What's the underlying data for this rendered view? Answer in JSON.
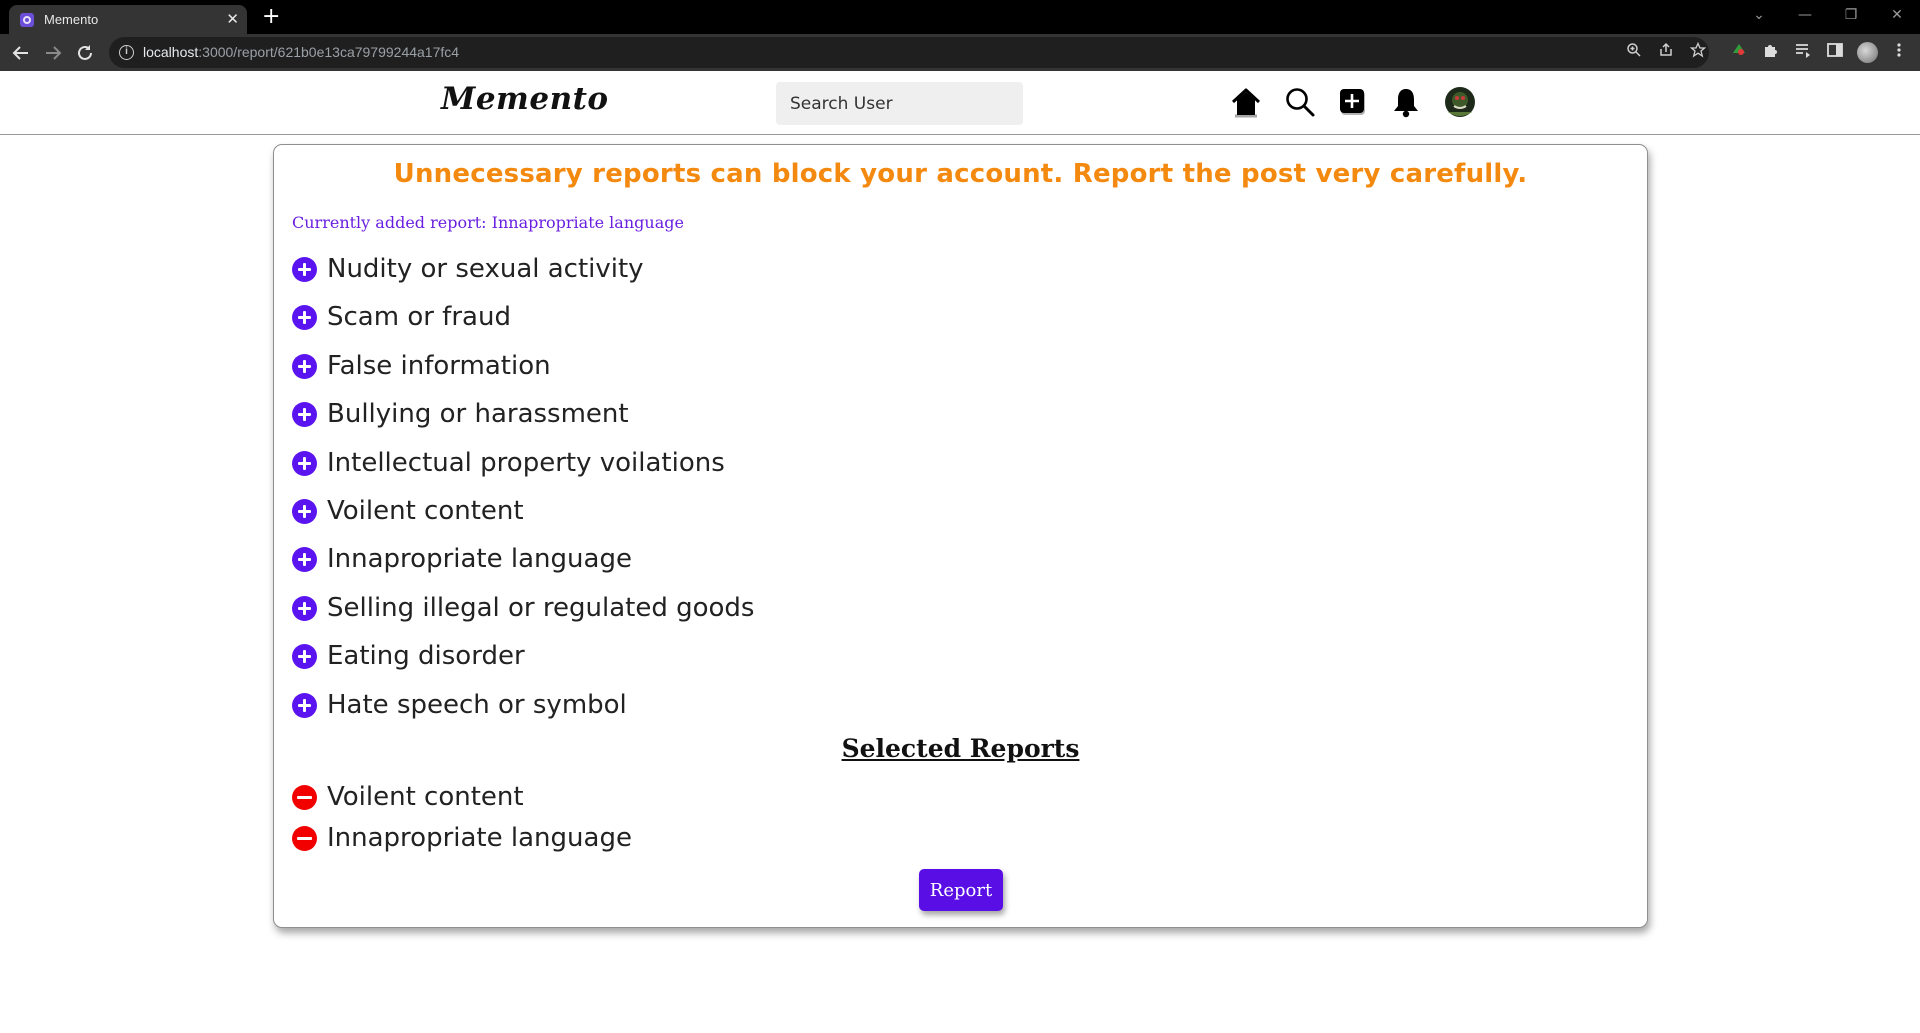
{
  "browser": {
    "tab_title": "Memento",
    "tab_close": "✕",
    "new_tab": "+",
    "url_host": "localhost",
    "url_path": ":3000/report/621b0e13ca79799244a17fc4",
    "window_controls": [
      "⌄",
      "—",
      "❐",
      "✕"
    ]
  },
  "nav": {
    "logo": "Memento",
    "search_placeholder": "Search User",
    "icons": [
      "home-icon",
      "search-icon",
      "create-post-icon",
      "notifications-bell-icon",
      "profile-avatar"
    ]
  },
  "report": {
    "warning": "Unnecessary reports can block your account. Report the post very carefully.",
    "current_report": "Currently added report: Innapropriate language",
    "options": [
      "Nudity or sexual activity",
      "Scam or fraud",
      "False information",
      "Bullying or harassment",
      "Intellectual property voilations",
      "Voilent content",
      "Innapropriate language",
      "Selling illegal or regulated goods",
      "Eating disorder",
      "Hate speech or symbol"
    ],
    "selected_heading": "Selected Reports",
    "selected": [
      "Voilent content",
      "Innapropriate language"
    ],
    "submit_label": "Report"
  },
  "colors": {
    "accent_purple": "#5a14f0",
    "warning_orange": "#f4890f",
    "remove_red": "#f20000"
  }
}
